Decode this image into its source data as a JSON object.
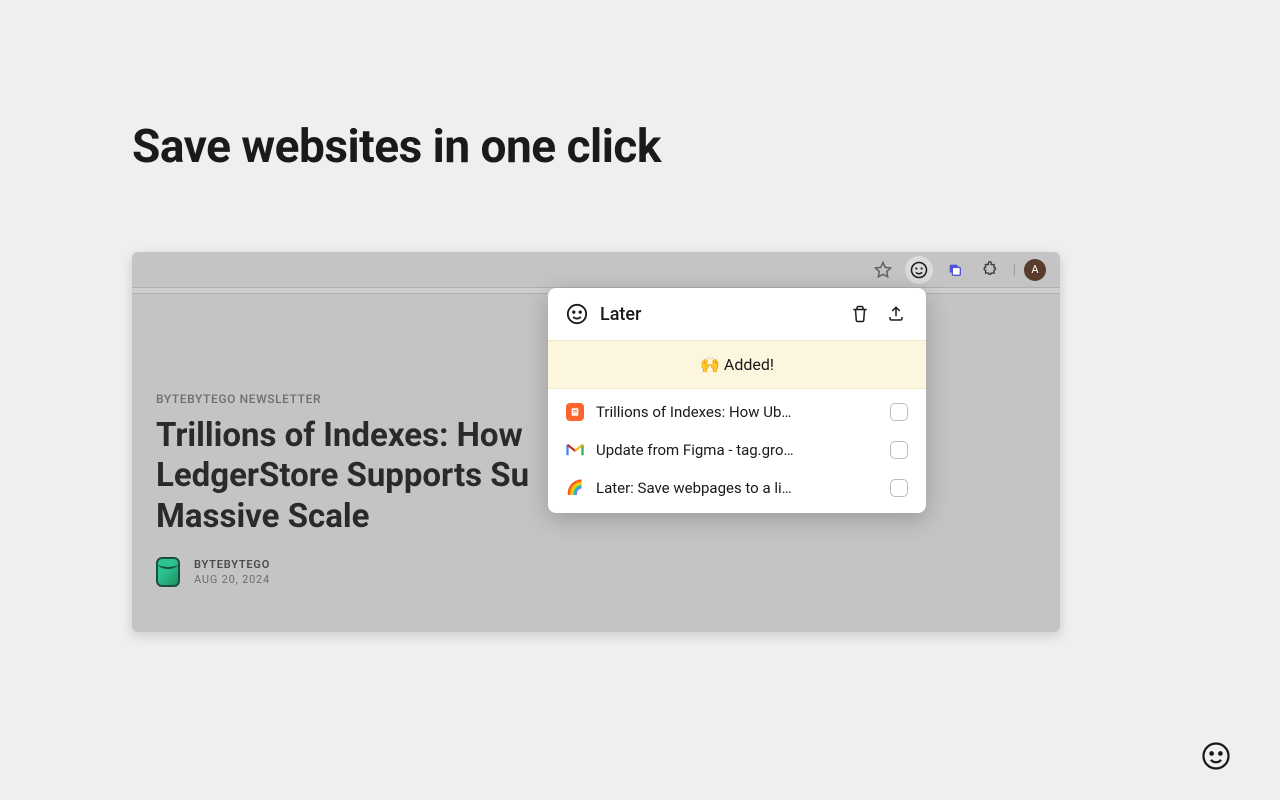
{
  "headline": "Save websites in one click",
  "toolbar": {
    "avatar_initial": "A"
  },
  "article": {
    "kicker": "BYTEBYTEGO NEWSLETTER",
    "title_line1": "Trillions of Indexes: How",
    "title_line2": "LedgerStore Supports Su",
    "title_line3": "Massive Scale",
    "author": "BYTEBYTEGO",
    "date": "AUG 20, 2024"
  },
  "popup": {
    "brand": "Later",
    "added_text": "🙌 Added!",
    "items": [
      {
        "title": "Trillions of Indexes: How Ub…",
        "icon": "orange"
      },
      {
        "title": "Update from Figma - tag.gro…",
        "icon": "gmail"
      },
      {
        "title": "Later: Save webpages to a li…",
        "icon": "rainbow"
      }
    ]
  }
}
